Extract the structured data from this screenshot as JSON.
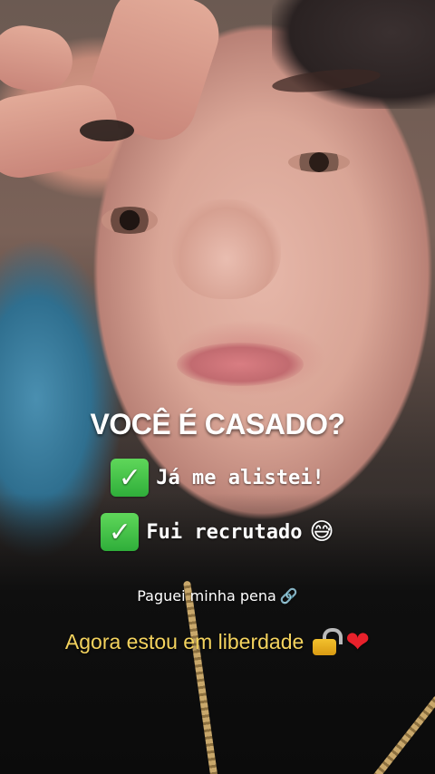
{
  "story": {
    "headline": "VOCÊ É CASADO?",
    "checklist": [
      {
        "text": "Já me alistei!",
        "icon": "check-box-icon",
        "trailing_emoji": ""
      },
      {
        "text": "Fui recrutado",
        "icon": "check-box-icon",
        "trailing_emoji": "😅"
      }
    ],
    "note": "Paguei minha pena",
    "note_icon": "link-icon",
    "freedom": "Agora estou em liberdade",
    "freedom_icons": [
      "unlocked-lock-icon",
      "red-heart-icon"
    ]
  },
  "colors": {
    "headline": "#ffffff",
    "check": "#2fae3a",
    "freedom_text": "#f4d35e",
    "heart": "#e8212b"
  },
  "glyphs": {
    "check": "✓",
    "link": "🔗",
    "heart": "❤"
  }
}
